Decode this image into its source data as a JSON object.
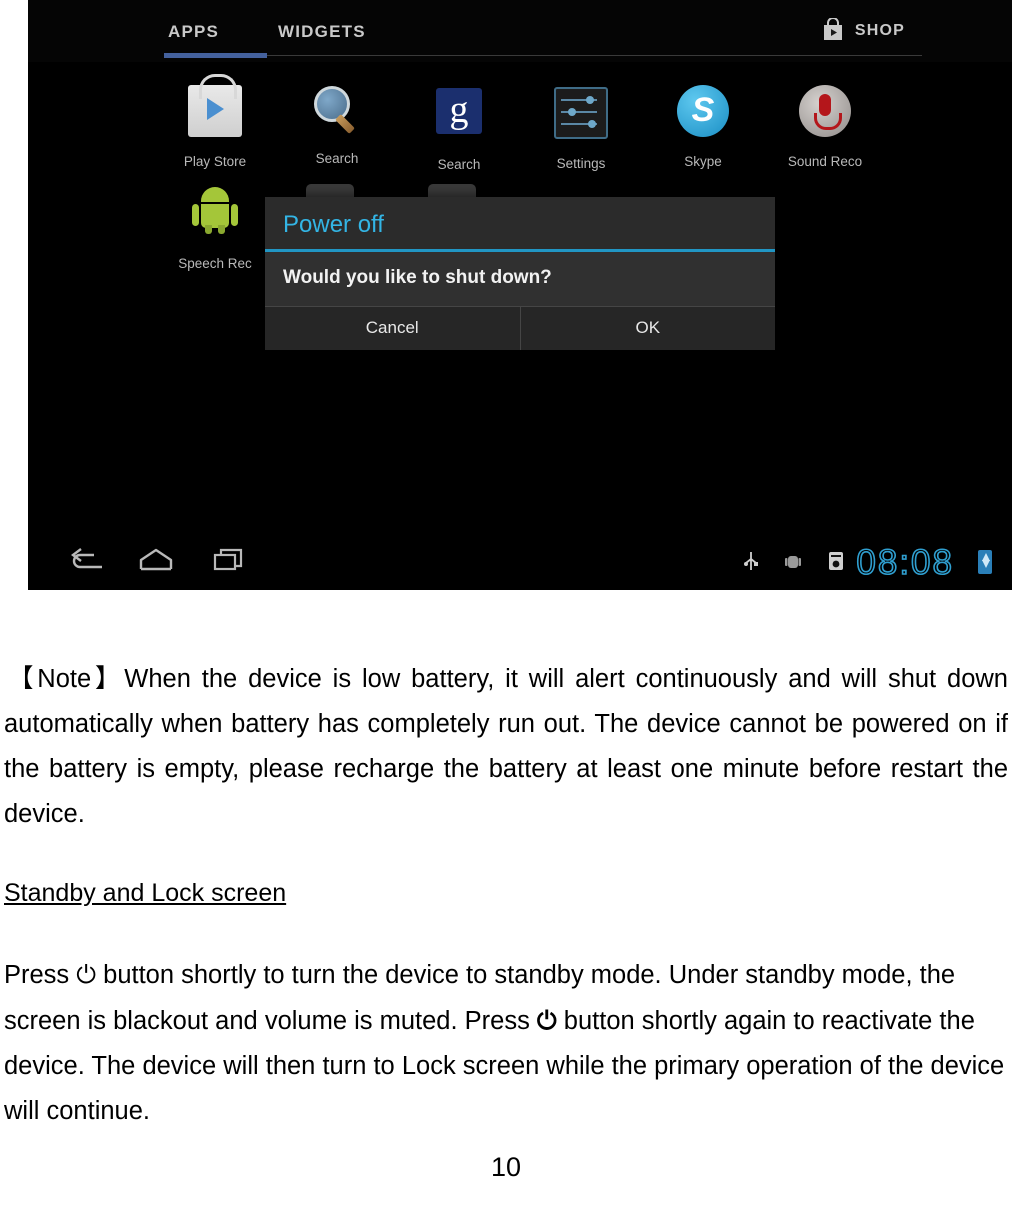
{
  "screenshot": {
    "tabs": [
      {
        "label": "APPS",
        "selected": true
      },
      {
        "label": "WIDGETS",
        "selected": false
      }
    ],
    "shop_label": "SHOP",
    "apps": [
      {
        "label": "Play Store",
        "icon": "play-store-icon"
      },
      {
        "label": "Search",
        "icon": "search-magnifier-icon"
      },
      {
        "label": "Search",
        "icon": "google-search-icon"
      },
      {
        "label": "Settings",
        "icon": "settings-sliders-icon"
      },
      {
        "label": "Skype",
        "icon": "skype-icon"
      },
      {
        "label": "Sound Reco",
        "icon": "sound-recorder-icon"
      },
      {
        "label": "Speech Rec",
        "icon": "android-robot-icon"
      }
    ],
    "dialog": {
      "title": "Power off",
      "message": "Would you like to shut down?",
      "cancel_label": "Cancel",
      "ok_label": "OK",
      "title_color": "#33b5e5",
      "background_color": "#2b2b2b"
    },
    "navbar": {
      "back": "back-icon",
      "home": "home-icon",
      "recents": "recent-apps-icon"
    },
    "status": {
      "usb_icon": "usb-icon",
      "debug_icon": "android-debug-icon",
      "update_icon": "system-update-icon",
      "clock": "08:08",
      "battery_icon": "battery-charging-icon",
      "clock_color": "#2f9fd0"
    }
  },
  "document": {
    "note_paragraph": "【Note】When the device is low battery, it will alert continuously and will shut down automatically when battery has completely run out.  The device cannot be powered on if the battery is empty, please recharge the battery at least one minute before restart the device.",
    "heading": "Standby and Lock screen",
    "body_part1": "Press ",
    "power_glyph_1": "⏻",
    "body_part2": " button shortly to turn the device to standby mode.   Under standby mode, the screen is blackout and volume is muted.    Press ",
    "power_glyph_2": "⏻",
    "body_part3": " button shortly again to reactivate the device.     The device will then turn to Lock screen while the primary operation of the device will continue.",
    "page_number": "10"
  }
}
